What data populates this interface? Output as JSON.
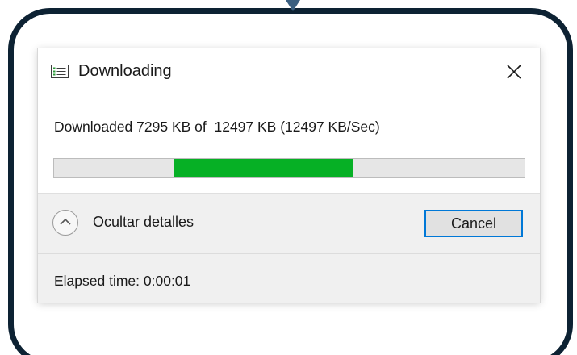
{
  "dialog": {
    "title": "Downloading",
    "icon": "list-window-icon",
    "close_icon": "close-icon"
  },
  "status": {
    "prefix": "Downloaded 7295 KB of  12497 KB (12497 KB/Sec)",
    "downloaded_kb": 7295,
    "total_kb": 12497,
    "rate": "12497 KB/Sec"
  },
  "progress": {
    "style": "marquee",
    "segment_start": 0.255,
    "segment_end": 0.635,
    "fill_color": "#06b025",
    "track_color": "#e6e6e6"
  },
  "details": {
    "toggle_label": "Ocultar detalles",
    "toggle_icon": "chevron-up-icon",
    "cancel_label": "Cancel",
    "elapsed": "Elapsed time: 0:00:01"
  },
  "colors": {
    "frame": "#0d2233",
    "accent": "#0078d7",
    "pointer": "#3a5f80"
  }
}
